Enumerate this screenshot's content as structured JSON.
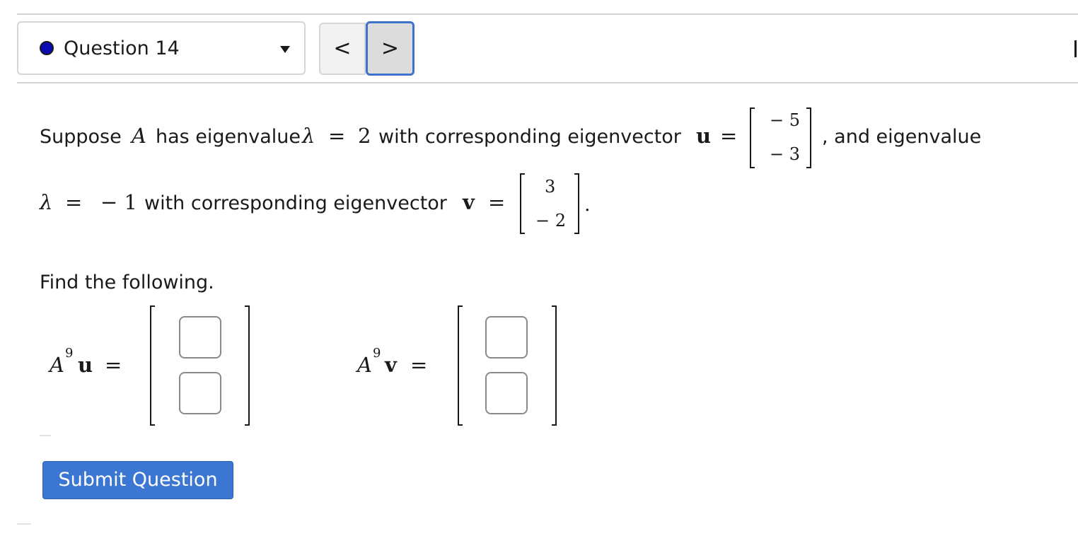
{
  "nav": {
    "question_label": "Question 14",
    "prev_symbol": "<",
    "next_symbol": ">",
    "status_color": "#0b0bb3"
  },
  "problem": {
    "line1_prefix": "Suppose",
    "matrix_A": "A",
    "line1_mid": "has eigenvalue",
    "lambda": "λ",
    "equals": "=",
    "lambda1_value": "2",
    "line1_with": "with corresponding eigenvector",
    "vec_u": "u",
    "u_entries": [
      "− 5",
      "− 3"
    ],
    "line1_suffix": ", and eigenvalue",
    "lambda2_value": "− 1",
    "line2_with": "with corresponding eigenvector",
    "vec_v": "v",
    "v_entries": [
      "3",
      "− 2"
    ],
    "period": ".",
    "instruction": "Find the following."
  },
  "answers": {
    "power": "9",
    "u_expr_A": "A",
    "u_expr_vec": "u",
    "v_expr_A": "A",
    "v_expr_vec": "v",
    "equals": "="
  },
  "submit_label": "Submit Question",
  "accent_color": "#3b76d3"
}
